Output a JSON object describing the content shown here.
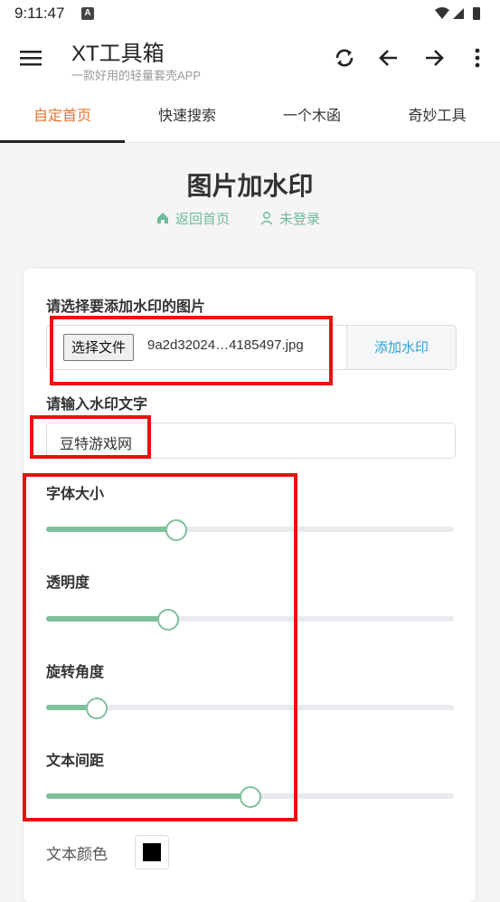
{
  "status_bar": {
    "time": "9:11:47",
    "badge": "A"
  },
  "app_bar": {
    "title": "XT工具箱",
    "subtitle": "一款好用的轻量套壳APP"
  },
  "tabs": [
    {
      "label": "自定首页",
      "active": true
    },
    {
      "label": "快速搜索",
      "active": false
    },
    {
      "label": "一个木函",
      "active": false
    },
    {
      "label": "奇妙工具",
      "active": false
    }
  ],
  "page": {
    "title": "图片加水印",
    "back_home": "返回首页",
    "login_status": "未登录"
  },
  "form": {
    "image_label": "请选择要添加水印的图片",
    "file_button": "选择文件",
    "file_name": "9a2d32024…4185497.jpg",
    "add_watermark_button": "添加水印",
    "text_label": "请输入水印文字",
    "text_value": "豆特游戏网",
    "sliders": [
      {
        "label": "字体大小",
        "value": 0.32
      },
      {
        "label": "透明度",
        "value": 0.3
      },
      {
        "label": "旋转角度",
        "value": 0.125
      },
      {
        "label": "文本间距",
        "value": 0.5
      }
    ],
    "color_label": "文本颜色",
    "color_value": "#000000"
  },
  "colors": {
    "accent_tab": "#e8742b",
    "link_green": "#6fba97",
    "slider_green": "#7ec09c",
    "action_blue": "#2da4d9",
    "highlight_red": "#e81010"
  }
}
